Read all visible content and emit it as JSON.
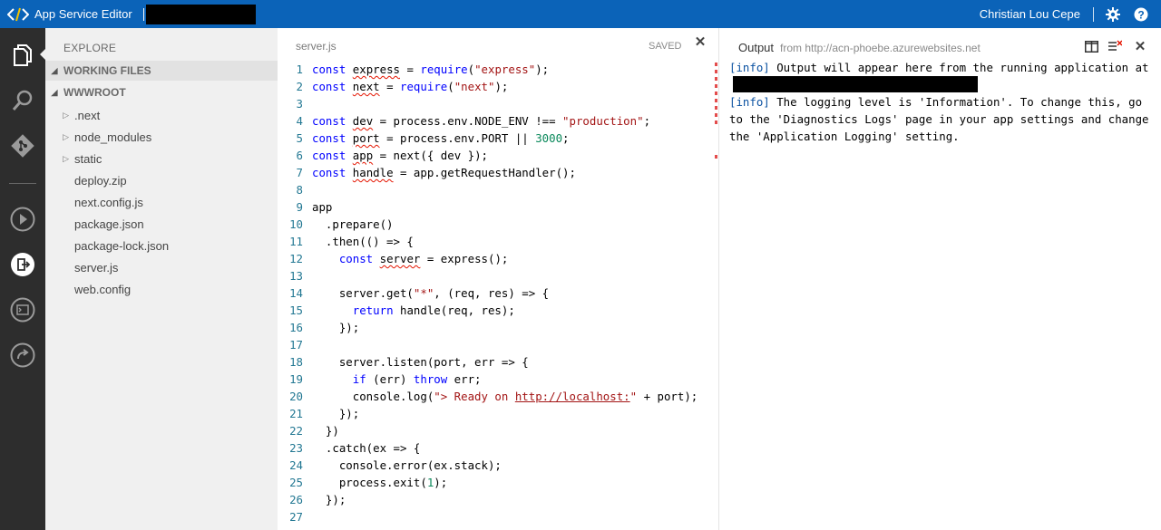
{
  "topbar": {
    "app_title": "App Service Editor",
    "user_name": "Christian Lou Cepe",
    "settings_icon": "gear-icon",
    "help_icon": "help-icon",
    "bg_color": "#0b63b8"
  },
  "activity_bar": {
    "items": [
      "explorer-icon",
      "search-icon",
      "git-icon",
      "run-icon",
      "output-icon",
      "console-icon",
      "publish-icon"
    ],
    "bg_color": "#2d2d2d"
  },
  "sidebar": {
    "title": "EXPLORE",
    "working_files_label": "WORKING FILES",
    "wwwroot_label": "WWWROOT",
    "folders": [
      ".next",
      "node_modules",
      "static"
    ],
    "files": [
      "deploy.zip",
      "next.config.js",
      "package.json",
      "package-lock.json",
      "server.js",
      "web.config"
    ]
  },
  "editor": {
    "filename": "server.js",
    "status": "SAVED",
    "close_icon": "close-icon",
    "line_numbers": [
      "1",
      "2",
      "3",
      "4",
      "5",
      "6",
      "7",
      "8",
      "9",
      "10",
      "11",
      "12",
      "13",
      "14",
      "15",
      "16",
      "17",
      "18",
      "19",
      "20",
      "21",
      "22",
      "23",
      "24",
      "25",
      "26",
      "27"
    ],
    "code_text": [
      "const express = require(\"express\");",
      "const next = require(\"next\");",
      "",
      "const dev = process.env.NODE_ENV !== \"production\";",
      "const port = process.env.PORT || 3000;",
      "const app = next({ dev });",
      "const handle = app.getRequestHandler();",
      "",
      "app",
      "  .prepare()",
      "  .then(() => {",
      "    const server = express();",
      "",
      "    server.get(\"*\", (req, res) => {",
      "      return handle(req, res);",
      "    });",
      "",
      "    server.listen(port, err => {",
      "      if (err) throw err;",
      "      console.log(\"> Ready on http://localhost:\" + port);",
      "    });",
      "  })",
      "  .catch(ex => {",
      "    console.error(ex.stack);",
      "    process.exit(1);",
      "  });",
      ""
    ]
  },
  "output": {
    "title": "Output",
    "source": "from http://acn-phoebe.azurewebsites.net",
    "line1_tag": "[info]",
    "line1_text": " Output will appear here from the running application at",
    "line2_tag": "[info]",
    "line2_text": " The logging level is 'Information'. To change this, go to the 'Diagnostics Logs' page in your app settings and change the 'Application Logging' setting.",
    "split_icon": "split-view-icon",
    "clear_icon": "clear-output-icon",
    "close_icon": "close-icon"
  }
}
